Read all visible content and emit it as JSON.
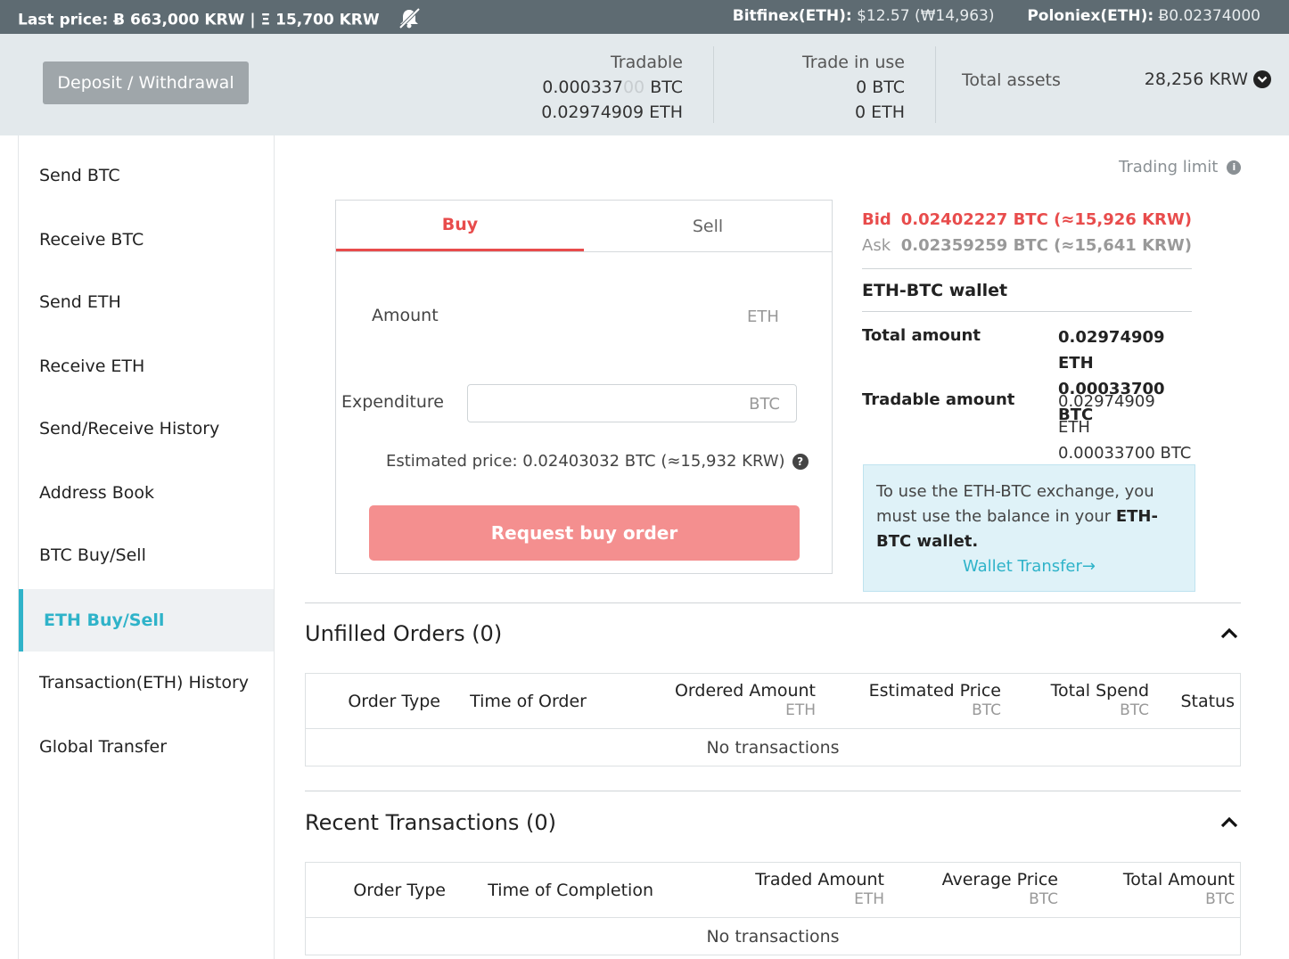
{
  "topbar": {
    "last_price": "Last price: Ƀ 663,000 KRW | Ξ 15,700 KRW",
    "bitfinex_label": "Bitfinex(ETH):",
    "bitfinex_value": "$12.57 (₩14,963)",
    "poloniex_label": "Poloniex(ETH):",
    "poloniex_value": "Ƀ0.02374000"
  },
  "balances": {
    "deposit_label": "Deposit / Withdrawal",
    "tradable_header": "Tradable",
    "tradable_btc_main": "0.000337",
    "tradable_btc_faded": "00",
    "tradable_btc_unit": " BTC",
    "tradable_eth": "0.02974909 ETH",
    "in_use_header": "Trade in use",
    "in_use_btc": "0 BTC",
    "in_use_eth": "0 ETH",
    "total_label": "Total assets",
    "total_value": "28,256 KRW"
  },
  "sidebar": {
    "items": [
      {
        "label": "Send BTC"
      },
      {
        "label": "Receive BTC"
      },
      {
        "label": "Send ETH"
      },
      {
        "label": "Receive ETH"
      },
      {
        "label": "Send/Receive History"
      },
      {
        "label": "Address Book"
      },
      {
        "label": "BTC Buy/Sell"
      },
      {
        "label": "ETH Buy/Sell"
      },
      {
        "label": "Transaction(ETH) History"
      },
      {
        "label": "Global Transfer"
      }
    ],
    "active_index": 7
  },
  "trading_limit": "Trading limit",
  "order_form": {
    "tab_buy": "Buy",
    "tab_sell": "Sell",
    "amount_label": "Amount",
    "amount_unit": "ETH",
    "expenditure_label": "Expenditure",
    "expenditure_unit": "BTC",
    "estimated_price": "Estimated price: 0.02403032 BTC (≈15,932 KRW)",
    "submit_label": "Request buy order"
  },
  "market": {
    "bid_label": "Bid",
    "bid_value": "0.02402227 BTC (≈15,926 KRW)",
    "ask_label": "Ask",
    "ask_value": "0.02359259 BTC (≈15,641 KRW)"
  },
  "wallet": {
    "title": "ETH-BTC wallet",
    "total_label": "Total amount",
    "total_eth": "0.02974909 ETH",
    "total_btc": "0.00033700 BTC",
    "tradable_label": "Tradable amount",
    "tradable_eth": "0.02974909 ETH",
    "tradable_btc": "0.00033700 BTC"
  },
  "notice": {
    "text_before": "To use the ETH-BTC exchange, you must use the balance in your ",
    "text_bold": "ETH-BTC wallet.",
    "link": "Wallet Transfer→"
  },
  "unfilled": {
    "title": "Unfilled Orders (0)",
    "columns": [
      "Order Type",
      "Time of Order",
      "Ordered Amount",
      "Estimated Price",
      "Total Spend",
      "Status"
    ],
    "units": [
      "",
      "",
      "ETH",
      "BTC",
      "BTC",
      ""
    ],
    "empty": "No transactions"
  },
  "recent": {
    "title": "Recent Transactions (0)",
    "columns": [
      "Order Type",
      "Time of Completion",
      "Traded Amount",
      "Average Price",
      "Total Amount"
    ],
    "units": [
      "",
      "",
      "ETH",
      "BTC",
      "BTC"
    ],
    "empty": "No transactions"
  },
  "colors": {
    "topbar": "#5e6b72",
    "accent": "#2fb3c9",
    "buy": "#e84c4c",
    "buy_button": "#f48f8f"
  },
  "icons": {
    "topbar": "mute-bell-icon",
    "total": "chevron-down-circle-icon",
    "trading_limit": "info-icon",
    "estimate": "help-icon",
    "collapse": "chevron-up-icon"
  }
}
